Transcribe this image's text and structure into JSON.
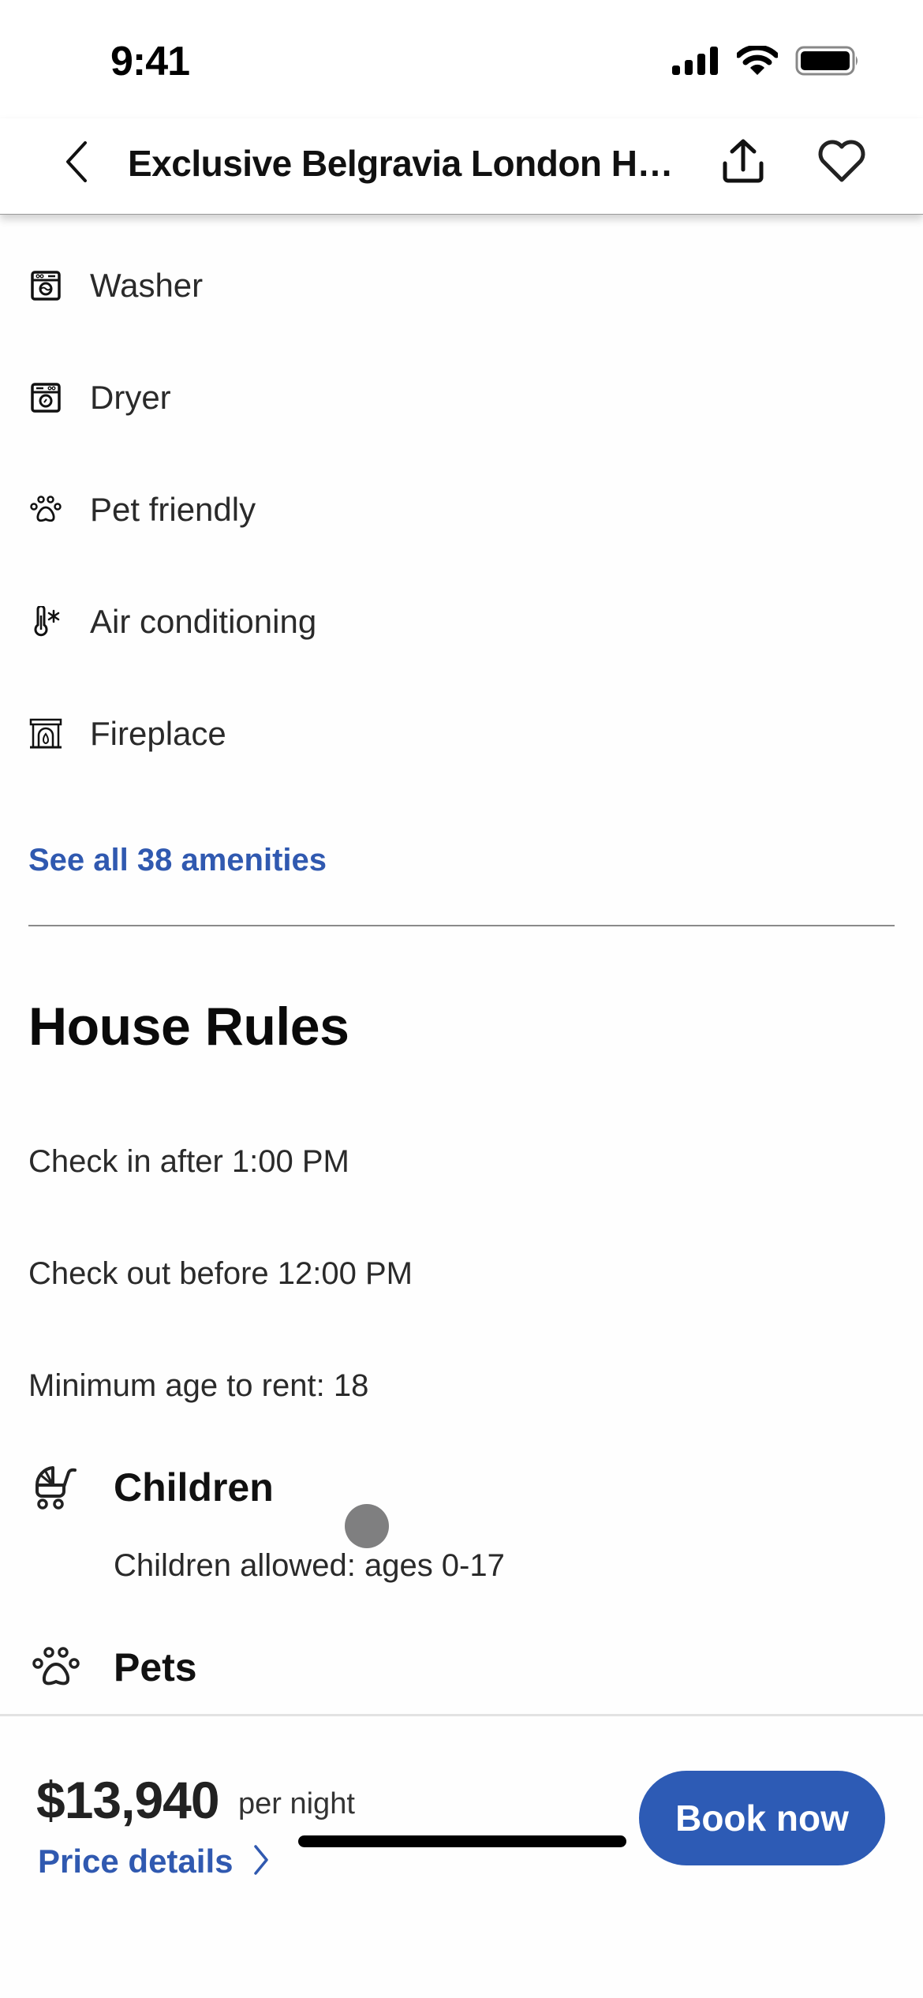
{
  "status_bar": {
    "time": "9:41",
    "icons": [
      "cellular-signal-icon",
      "wifi-icon",
      "battery-icon"
    ]
  },
  "header": {
    "title": "Exclusive Belgravia London House",
    "back_icon": "chevron-left-icon",
    "share_icon": "share-icon",
    "favorite_icon": "heart-outline-icon"
  },
  "amenities": {
    "items": [
      {
        "label": "Washer",
        "icon": "washer-icon"
      },
      {
        "label": "Dryer",
        "icon": "dryer-icon"
      },
      {
        "label": "Pet friendly",
        "icon": "paw-icon"
      },
      {
        "label": "Air conditioning",
        "icon": "thermometer-snowflake-icon"
      },
      {
        "label": "Fireplace",
        "icon": "fireplace-icon"
      }
    ],
    "see_all_label": "See all 38 amenities"
  },
  "house_rules": {
    "title": "House Rules",
    "rules": [
      "Check in after 1:00 PM",
      "Check out before 12:00 PM",
      "Minimum age to rent: 18"
    ],
    "groups": [
      {
        "title": "Children",
        "icon": "stroller-icon",
        "detail": "Children allowed: ages 0-17"
      },
      {
        "title": "Pets",
        "icon": "paw-icon",
        "detail": ""
      }
    ]
  },
  "booking_bar": {
    "price": "$13,940",
    "price_unit": "per night",
    "price_details_label": "Price details",
    "book_label": "Book now",
    "accent_color": "#2d5bb5",
    "link_color": "#3059b0"
  }
}
